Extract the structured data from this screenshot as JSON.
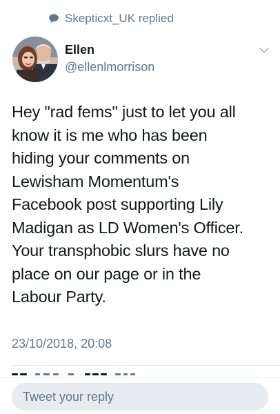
{
  "context": {
    "replied_text": "Skepticxt_UK replied",
    "icon": "speech-bubble-icon"
  },
  "author": {
    "display_name": "Ellen",
    "handle": "@ellenlmorrison",
    "avatar_icon": "user-avatar"
  },
  "tweet": {
    "text": "Hey \"rad fems\" just to let you all\nknow it is me who has been\nhiding your comments on\nLewisham Momentum's\nFacebook post supporting Lily\nMadigan as LD Women's Officer.\nYour transphobic slurs have no\nplace on our page or in the\nLabour Party.",
    "timestamp": "23/10/2018, 20:08",
    "menu_icon": "chevron-down-icon"
  },
  "reply": {
    "placeholder": "Tweet your reply"
  },
  "colors": {
    "primary_text": "#14171a",
    "secondary_text": "#657786",
    "input_background": "#e6ecf0",
    "divider": "#e1e8ed"
  }
}
